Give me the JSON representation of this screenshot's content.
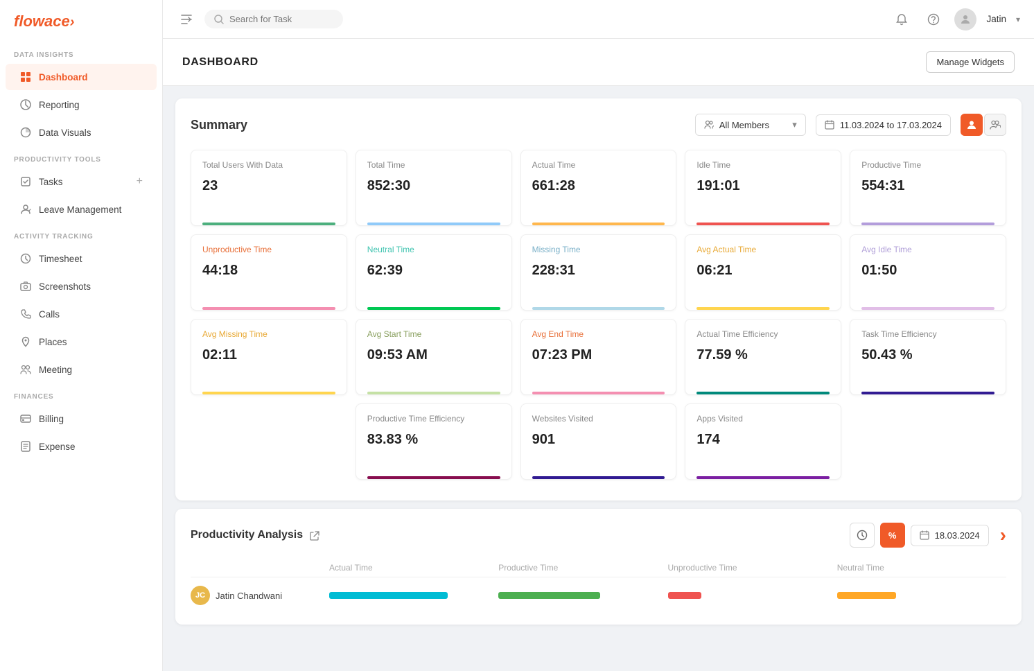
{
  "logo": {
    "text_flow": "flow",
    "text_ace": "ace",
    "arrow": "›"
  },
  "topbar": {
    "search_placeholder": "Search for Task",
    "user_name": "Jatin",
    "collapse_icon": "❮"
  },
  "sidebar": {
    "sections": [
      {
        "label": "DATA INSIGHTS",
        "items": [
          {
            "id": "dashboard",
            "label": "Dashboard",
            "active": true,
            "icon": "grid"
          },
          {
            "id": "reporting",
            "label": "Reporting",
            "active": false,
            "icon": "bar-chart"
          },
          {
            "id": "data-visuals",
            "label": "Data Visuals",
            "active": false,
            "icon": "pie-chart"
          }
        ]
      },
      {
        "label": "PRODUCTIVITY TOOLS",
        "items": [
          {
            "id": "tasks",
            "label": "Tasks",
            "active": false,
            "icon": "check-square",
            "has_plus": true
          },
          {
            "id": "leave-management",
            "label": "Leave Management",
            "active": false,
            "icon": "user-check"
          }
        ]
      },
      {
        "label": "ACTIVITY TRACKING",
        "items": [
          {
            "id": "timesheet",
            "label": "Timesheet",
            "active": false,
            "icon": "clock"
          },
          {
            "id": "screenshots",
            "label": "Screenshots",
            "active": false,
            "icon": "camera"
          },
          {
            "id": "calls",
            "label": "Calls",
            "active": false,
            "icon": "phone"
          },
          {
            "id": "places",
            "label": "Places",
            "active": false,
            "icon": "map-pin"
          },
          {
            "id": "meeting",
            "label": "Meeting",
            "active": false,
            "icon": "users"
          }
        ]
      },
      {
        "label": "FINANCES",
        "items": [
          {
            "id": "billing",
            "label": "Billing",
            "active": false,
            "icon": "credit-card"
          },
          {
            "id": "expense",
            "label": "Expense",
            "active": false,
            "icon": "file-text"
          }
        ]
      }
    ]
  },
  "page": {
    "title": "DASHBOARD",
    "manage_widgets_label": "Manage Widgets"
  },
  "summary": {
    "title": "Summary",
    "filter_members": "All Members",
    "filter_date": "11.03.2024 to 17.03.2024",
    "metrics_row1": [
      {
        "id": "total-users",
        "label": "Total Users With Data",
        "value": "23",
        "bar_color": "#4caf7d",
        "label_color": "#333"
      },
      {
        "id": "total-time",
        "label": "Total Time",
        "value": "852:30",
        "bar_color": "#90caf9",
        "label_color": "#333"
      },
      {
        "id": "actual-time",
        "label": "Actual Time",
        "value": "661:28",
        "bar_color": "#ffb74d",
        "label_color": "#333"
      },
      {
        "id": "idle-time",
        "label": "Idle Time",
        "value": "191:01",
        "bar_color": "#ef5350",
        "label_color": "#333"
      },
      {
        "id": "productive-time",
        "label": "Productive Time",
        "value": "554:31",
        "bar_color": "#b39ddb",
        "label_color": "#333"
      }
    ],
    "metrics_row2": [
      {
        "id": "unproductive-time",
        "label": "Unproductive Time",
        "value": "44:18",
        "bar_color": "#f48fb1",
        "label_color": "#e8703a"
      },
      {
        "id": "neutral-time",
        "label": "Neutral Time",
        "value": "62:39",
        "bar_color": "#00c853",
        "label_color": "#40c4b0"
      },
      {
        "id": "missing-time",
        "label": "Missing Time",
        "value": "228:31",
        "bar_color": "#b0d8e8",
        "label_color": "#7ab0c8"
      },
      {
        "id": "avg-actual-time",
        "label": "Avg Actual Time",
        "value": "06:21",
        "bar_color": "#ffd54f",
        "label_color": "#e8a935"
      },
      {
        "id": "avg-idle-time",
        "label": "Avg Idle Time",
        "value": "01:50",
        "bar_color": "#e1bee7",
        "label_color": "#b09fd8"
      }
    ],
    "metrics_row3": [
      {
        "id": "avg-missing-time",
        "label": "Avg Missing Time",
        "value": "02:11",
        "bar_color": "#ffd54f",
        "label_color": "#e8a935"
      },
      {
        "id": "avg-start-time",
        "label": "Avg Start Time",
        "value": "09:53 AM",
        "bar_color": "#c5e1a5",
        "label_color": "#a0c060"
      },
      {
        "id": "avg-end-time",
        "label": "Avg End Time",
        "value": "07:23 PM",
        "bar_color": "#f48fb1",
        "label_color": "#e8703a"
      },
      {
        "id": "actual-time-efficiency",
        "label": "Actual Time Efficiency",
        "value": "77.59 %",
        "bar_color": "#00897b",
        "label_color": "#333"
      },
      {
        "id": "task-time-efficiency",
        "label": "Task Time Efficiency",
        "value": "50.43 %",
        "bar_color": "#311b92",
        "label_color": "#333"
      }
    ],
    "metrics_row4": [
      {
        "id": "productive-time-efficiency",
        "label": "Productive Time Efficiency",
        "value": "83.83 %",
        "bar_color": "#880e4f",
        "label_color": "#333"
      },
      {
        "id": "websites-visited",
        "label": "Websites Visited",
        "value": "901",
        "bar_color": "#311b92",
        "label_color": "#333"
      },
      {
        "id": "apps-visited",
        "label": "Apps Visited",
        "value": "174",
        "bar_color": "#7b1fa2",
        "label_color": "#333"
      }
    ]
  },
  "productivity_analysis": {
    "title": "Productivity Analysis",
    "date": "18.03.2024",
    "table_headers": [
      "Actual Time",
      "Productive Time",
      "Unproductive Time",
      "Neutral Time"
    ],
    "rows": [
      {
        "name": "Jatin Chandwani",
        "initials": "JC",
        "avatar_color": "#e8b84b"
      }
    ]
  }
}
